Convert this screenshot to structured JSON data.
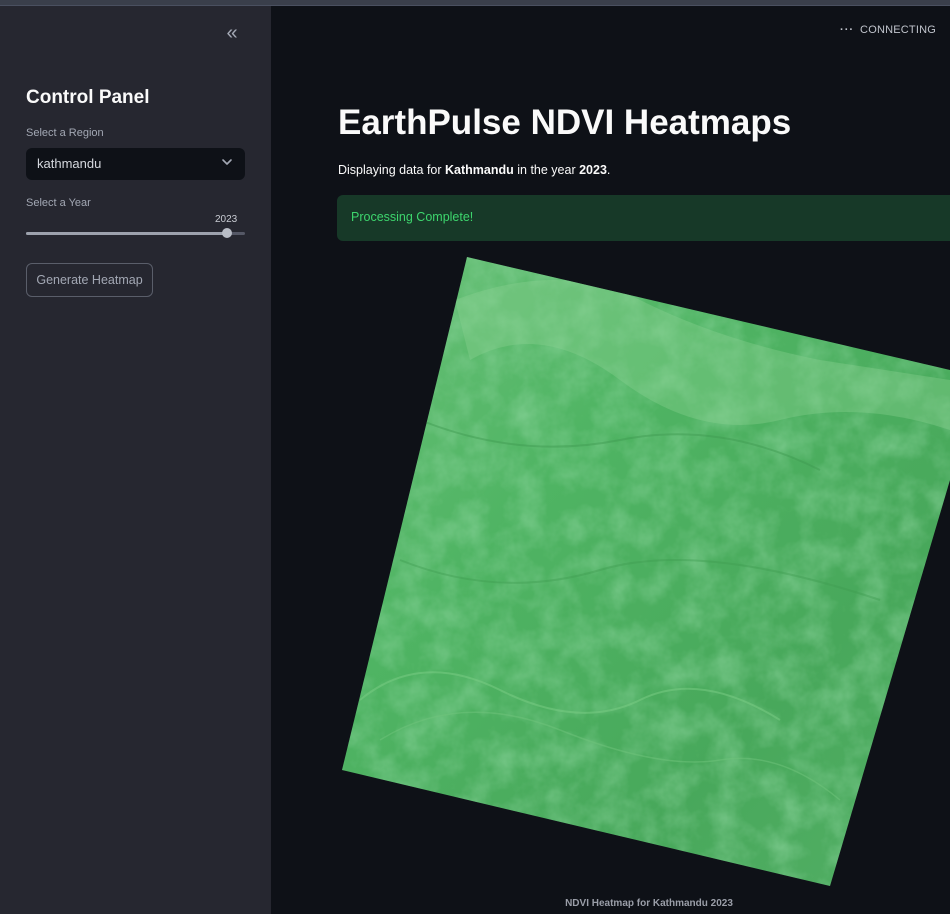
{
  "sidebar": {
    "collapse_icon": "double-chevron-left-icon",
    "title": "Control Panel",
    "region_label": "Select a Region",
    "region_value": "kathmandu",
    "year_label": "Select a Year",
    "year_value": "2023",
    "year_level_fraction": 1.0,
    "generate_button": "Generate Heatmap"
  },
  "status": {
    "icon": "more-dots-icon",
    "text": "CONNECTING"
  },
  "main": {
    "title": "EarthPulse NDVI Heatmaps",
    "desc_prefix": "Displaying data for ",
    "desc_region": "Kathmandu",
    "desc_middle": " in the year ",
    "desc_year": "2023",
    "desc_suffix": ".",
    "success_message": "Processing Complete!",
    "image_caption": "NDVI Heatmap for Kathmandu 2023"
  },
  "colors": {
    "sidebar_bg": "#262730",
    "main_bg": "#0e1117",
    "success_bg": "#173928",
    "success_text": "#3dd56d",
    "heatmap_green": "#4caf62"
  }
}
